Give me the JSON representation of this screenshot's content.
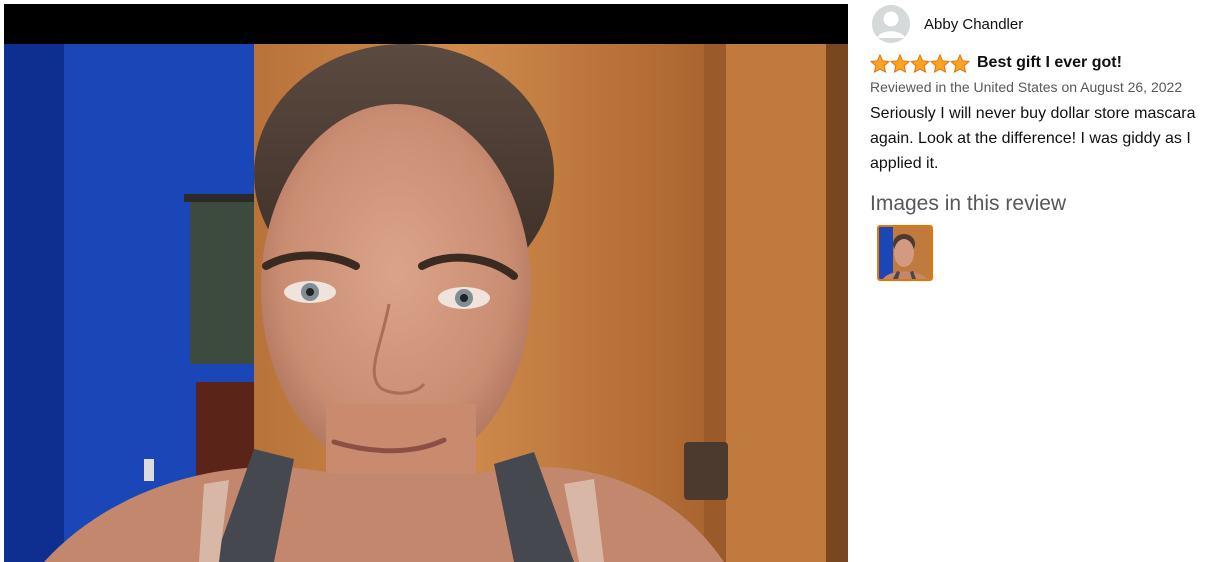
{
  "review": {
    "author_name": "Abby Chandler",
    "rating": 5,
    "rating_max": 5,
    "title": "Best gift I ever got!",
    "date_line": "Reviewed in the United States on August 26, 2022",
    "body": "Seriously I will never buy dollar store mascara again. Look at the difference! I was giddy as I applied it."
  },
  "images_section": {
    "heading": "Images in this review",
    "thumbnail_count": 1
  },
  "colors": {
    "star": "#ffa41c",
    "star_outline": "#de7921",
    "thumb_border": "#e77600"
  },
  "icons": {
    "avatar": "user-avatar-icon",
    "star": "star-icon"
  }
}
